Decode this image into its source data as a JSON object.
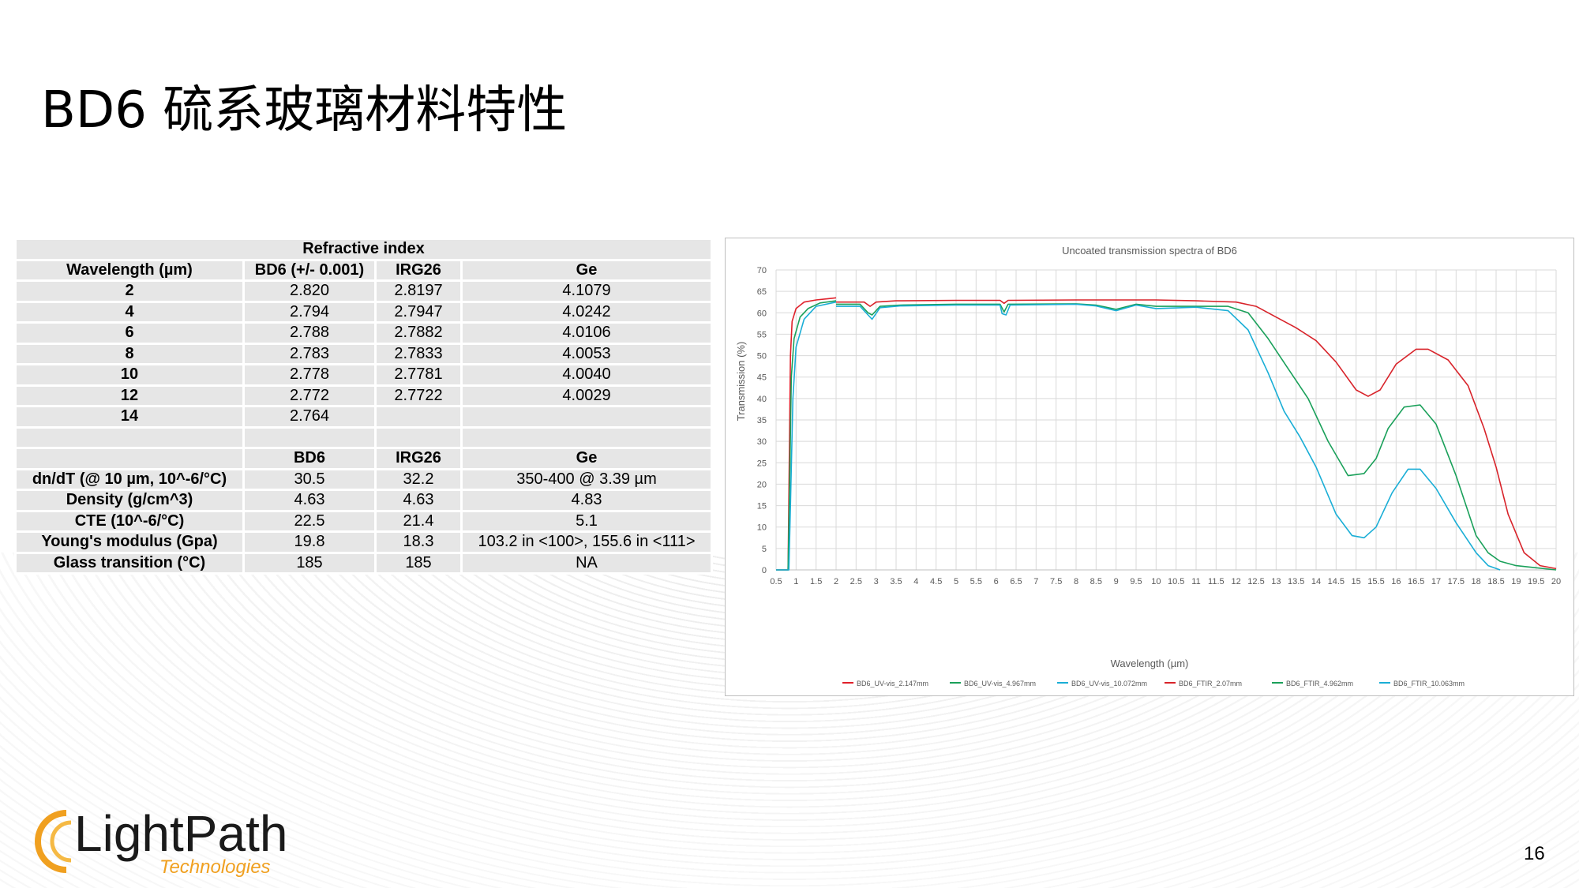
{
  "slide": {
    "title": "BD6 硫系玻璃材料特性",
    "page_number": "16"
  },
  "logo": {
    "name": "LightPath",
    "sub": "Technologies"
  },
  "table": {
    "header": "Refractive index",
    "ri_columns": [
      "Wavelength (µm)",
      "BD6 (+/- 0.001)",
      "IRG26",
      "Ge"
    ],
    "ri_rows": [
      [
        "2",
        "2.820",
        "2.8197",
        "4.1079"
      ],
      [
        "4",
        "2.794",
        "2.7947",
        "4.0242"
      ],
      [
        "6",
        "2.788",
        "2.7882",
        "4.0106"
      ],
      [
        "8",
        "2.783",
        "2.7833",
        "4.0053"
      ],
      [
        "10",
        "2.778",
        "2.7781",
        "4.0040"
      ],
      [
        "12",
        "2.772",
        "2.7722",
        "4.0029"
      ],
      [
        "14",
        "2.764",
        "",
        ""
      ]
    ],
    "prop_columns": [
      "",
      "BD6",
      "IRG26",
      "Ge"
    ],
    "prop_rows": [
      [
        "dn/dT (@ 10 µm, 10^-6/°C)",
        "30.5",
        "32.2",
        "350-400 @ 3.39 µm"
      ],
      [
        "Density (g/cm^3)",
        "4.63",
        "4.63",
        "4.83"
      ],
      [
        "CTE (10^-6/°C)",
        "22.5",
        "21.4",
        "5.1"
      ],
      [
        "Young's modulus (Gpa)",
        "19.8",
        "18.3",
        "103.2 in <100>, 155.6 in <111>"
      ],
      [
        "Glass transition (°C)",
        "185",
        "185",
        "NA"
      ]
    ]
  },
  "chart_data": {
    "type": "line",
    "title": "Uncoated transmission spectra of BD6",
    "xlabel": "Wavelength (µm)",
    "ylabel": "Transmission (%)",
    "xlim": [
      0.5,
      20
    ],
    "ylim": [
      0,
      70
    ],
    "xticks": [
      "0.5",
      "1",
      "1.5",
      "2",
      "2.5",
      "3",
      "3.5",
      "4",
      "4.5",
      "5",
      "5.5",
      "6",
      "6.5",
      "7",
      "7.5",
      "8",
      "8.5",
      "9",
      "9.5",
      "10",
      "10.5",
      "11",
      "11.5",
      "12",
      "12.5",
      "13",
      "13.5",
      "14",
      "14.5",
      "15",
      "15.5",
      "16",
      "16.5",
      "17",
      "17.5",
      "18",
      "18.5",
      "19",
      "19.5",
      "20"
    ],
    "yticks": [
      "0",
      "5",
      "10",
      "15",
      "20",
      "25",
      "30",
      "35",
      "40",
      "45",
      "50",
      "55",
      "60",
      "65",
      "70"
    ],
    "grid": true,
    "legend_position": "bottom",
    "series": [
      {
        "name": "BD6_UV-vis_2.147mm",
        "color": "#e0202a",
        "x": [
          0.5,
          0.8,
          0.83,
          0.86,
          0.9,
          1.0,
          1.2,
          1.5,
          1.8,
          2.0
        ],
        "y": [
          0,
          0,
          25,
          50,
          58,
          61,
          62.5,
          63,
          63.3,
          63.5
        ]
      },
      {
        "name": "BD6_UV-vis_4.967mm",
        "color": "#1aa05a",
        "x": [
          0.5,
          0.8,
          0.84,
          0.88,
          0.95,
          1.1,
          1.3,
          1.6,
          2.0
        ],
        "y": [
          0,
          0,
          20,
          45,
          54,
          59,
          61,
          62.3,
          62.8
        ]
      },
      {
        "name": "BD6_UV-vis_10.072mm",
        "color": "#1aaed6",
        "x": [
          0.5,
          0.82,
          0.86,
          0.92,
          1.0,
          1.2,
          1.5,
          2.0
        ],
        "y": [
          0,
          0,
          15,
          40,
          52,
          58.5,
          61.5,
          62.5
        ]
      },
      {
        "name": "BD6_FTIR_2.07mm",
        "color": "#d8232a",
        "x": [
          2.0,
          2.7,
          2.85,
          3.0,
          3.5,
          5.0,
          6.1,
          6.2,
          6.3,
          8.0,
          9.0,
          10.0,
          11.0,
          12.0,
          12.5,
          13.0,
          13.5,
          14.0,
          14.5,
          15.0,
          15.3,
          15.6,
          16.0,
          16.5,
          16.8,
          17.3,
          17.8,
          18.2,
          18.5,
          18.8,
          19.2,
          19.6,
          20.0
        ],
        "y": [
          62.5,
          62.5,
          61.5,
          62.5,
          62.8,
          62.9,
          62.9,
          62.2,
          62.9,
          63.0,
          63.0,
          63.0,
          62.8,
          62.5,
          61.5,
          59,
          56.5,
          53.5,
          48.5,
          42,
          40.5,
          42,
          48,
          51.5,
          51.5,
          49,
          43,
          33,
          24,
          13,
          4,
          1,
          0.3
        ]
      },
      {
        "name": "BD6_FTIR_4.962mm",
        "color": "#1aa05a",
        "x": [
          2.0,
          2.6,
          2.8,
          2.9,
          3.1,
          3.6,
          5.0,
          6.1,
          6.2,
          6.3,
          8.0,
          8.5,
          9.0,
          9.5,
          10.0,
          11.0,
          11.8,
          12.3,
          12.8,
          13.3,
          13.8,
          14.3,
          14.8,
          15.2,
          15.5,
          15.8,
          16.2,
          16.6,
          17.0,
          17.5,
          18.0,
          18.3,
          18.6,
          19.0,
          19.5,
          20.0
        ],
        "y": [
          62.0,
          62.0,
          60,
          59.5,
          61.5,
          61.8,
          62.0,
          62.0,
          60.2,
          62.0,
          62.1,
          61.8,
          60.8,
          62.0,
          61.5,
          61.5,
          61.5,
          60,
          54,
          47,
          40,
          30,
          22,
          22.5,
          26,
          33,
          38,
          38.5,
          34,
          22,
          8,
          4,
          2,
          1,
          0.5,
          0
        ]
      },
      {
        "name": "BD6_FTIR_10.063mm",
        "color": "#1aaed6",
        "x": [
          2.0,
          2.6,
          2.8,
          2.9,
          3.1,
          3.6,
          5.0,
          6.1,
          6.15,
          6.25,
          6.35,
          8.0,
          8.5,
          9.0,
          9.5,
          10.0,
          11.0,
          11.8,
          12.3,
          12.8,
          13.2,
          13.6,
          14.0,
          14.5,
          14.9,
          15.2,
          15.5,
          15.9,
          16.3,
          16.6,
          17.0,
          17.5,
          18.0,
          18.3,
          18.6
        ],
        "y": [
          61.5,
          61.5,
          59.5,
          58.5,
          61.2,
          61.6,
          61.8,
          61.8,
          59.8,
          59.5,
          61.8,
          62.0,
          61.6,
          60.5,
          61.8,
          61.0,
          61.3,
          60.5,
          56,
          46,
          37,
          31,
          24,
          13,
          8,
          7.5,
          10,
          18,
          23.5,
          23.5,
          19,
          11,
          4,
          1,
          0
        ]
      }
    ]
  }
}
